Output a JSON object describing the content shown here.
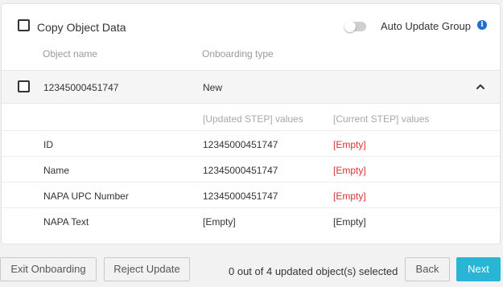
{
  "header": {
    "copy_label": "Copy Object Data",
    "auto_update_label": "Auto Update Group",
    "auto_update_on": false
  },
  "columns": {
    "object_name": "Object name",
    "onboarding_type": "Onboarding type"
  },
  "object": {
    "name": "12345000451747",
    "type": "New"
  },
  "values_header": {
    "updated": "[Updated STEP] values",
    "current": "[Current STEP] values"
  },
  "rows": [
    {
      "label": "ID",
      "updated": "12345000451747",
      "current": "[Empty]"
    },
    {
      "label": "Name",
      "updated": "12345000451747",
      "current": "[Empty]"
    },
    {
      "label": "NAPA UPC Number",
      "updated": "12345000451747",
      "current": "[Empty]"
    },
    {
      "label": "NAPA Text",
      "updated": "[Empty]",
      "current": "[Empty]"
    }
  ],
  "footer": {
    "exit_label": "Exit Onboarding",
    "reject_label": "Reject Update",
    "status": "0 out of 4 updated object(s) selected",
    "back_label": "Back",
    "next_label": "Next"
  },
  "colors": {
    "accent": "#29b5d6",
    "changed_value": "#d9343a",
    "info_icon": "#1e6fd0"
  }
}
